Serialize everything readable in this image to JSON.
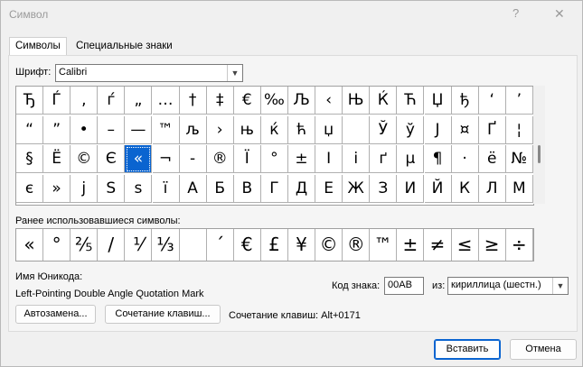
{
  "window": {
    "title": "Символ",
    "help": "?",
    "close": "✕"
  },
  "tabs": [
    {
      "label": "Символы"
    },
    {
      "label": "Специальные знаки"
    }
  ],
  "font": {
    "label": "Шрифт:",
    "value": "Calibri"
  },
  "symbols": [
    "Ђ",
    "Ѓ",
    "‚",
    "ѓ",
    "„",
    "…",
    "†",
    "‡",
    "€",
    "‰",
    "Љ",
    "‹",
    "Њ",
    "Ќ",
    "Ћ",
    "Џ",
    "ђ",
    "‘",
    "’",
    "“",
    "”",
    "•",
    "–",
    "—",
    "™",
    "љ",
    "›",
    "њ",
    "ќ",
    "ћ",
    "џ",
    " ",
    "Ў",
    "ў",
    "Ј",
    "¤",
    "Ґ",
    "¦",
    "§",
    "Ё",
    "©",
    "Є",
    "«",
    "¬",
    "-",
    "®",
    "Ї",
    "°",
    "±",
    "І",
    "і",
    "ґ",
    "µ",
    "¶",
    "·",
    "ё",
    "№",
    "є",
    "»",
    "j",
    "S",
    "s",
    "ï",
    "А",
    "Б",
    "В",
    "Г",
    "Д",
    "Е",
    "Ж",
    "З",
    "И",
    "Й",
    "К",
    "Л",
    "М"
  ],
  "selected_index": 42,
  "recent": {
    "label": "Ранее использовавшиеся символы:",
    "symbols": [
      "«",
      "°",
      "⅖",
      "/",
      "⅟",
      "⅓",
      " ",
      "´",
      "€",
      "£",
      "¥",
      "©",
      "®",
      "™",
      "±",
      "≠",
      "≤",
      "≥",
      "÷"
    ]
  },
  "unicode": {
    "label": "Имя Юникода:",
    "name": "Left-Pointing Double Angle Quotation Mark"
  },
  "code": {
    "label": "Код знака:",
    "value": "00AB",
    "from_label": "из:",
    "from_value": "кириллица (шестн.)"
  },
  "buttons": {
    "autocorrect": "Автозамена...",
    "shortcut": "Сочетание клавиш...",
    "insert": "Вставить",
    "cancel": "Отмена"
  },
  "shortcut_text": "Сочетание клавиш: Alt+0171"
}
